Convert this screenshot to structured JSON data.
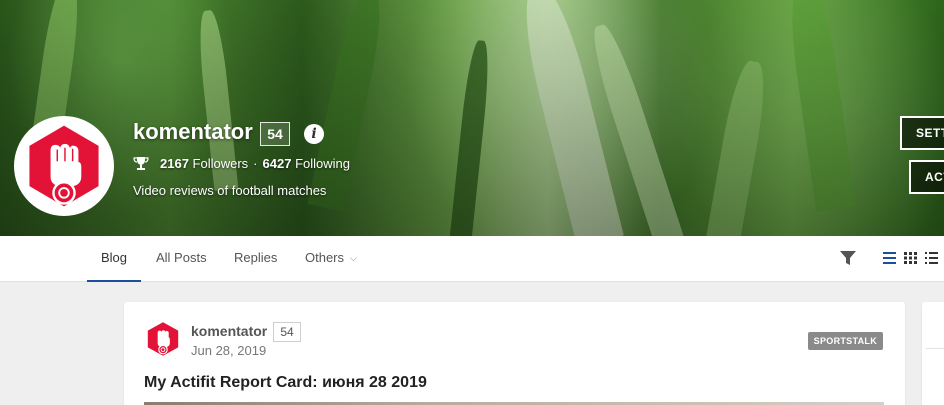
{
  "profile": {
    "name": "komentator",
    "reputation": "54",
    "info_icon": "i",
    "followers_count": "2167",
    "followers_label": "Followers",
    "separator": "·",
    "following_count": "6427",
    "following_label": "Following",
    "about": "Video reviews of football matches"
  },
  "cover_buttons": {
    "settings": "SETT",
    "activity": "ACT"
  },
  "tabs": {
    "blog": "Blog",
    "all_posts": "All Posts",
    "replies": "Replies",
    "others": "Others"
  },
  "icons": {
    "trophy": "trophy-icon",
    "filter": "filter-icon",
    "view_list": "list-view-icon",
    "view_grid": "grid-view-icon",
    "view_compact": "compact-view-icon",
    "others_chevron": "chevron-down-icon"
  },
  "post": {
    "author": "komentator",
    "reputation": "54",
    "date": "Jun 28, 2019",
    "tag": "SPORTSTALK",
    "title": "My Actifit Report Card: июня 28 2019"
  },
  "colors": {
    "accent": "#1a5099",
    "avatar_red": "#e31337",
    "tag_bg": "#8a8a8a"
  }
}
